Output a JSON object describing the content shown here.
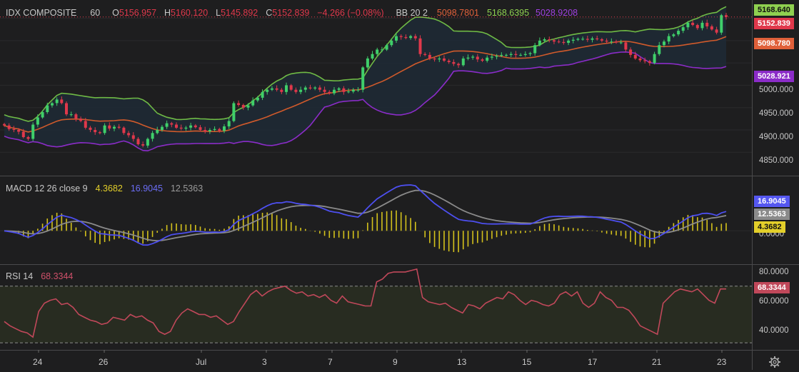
{
  "colors": {
    "bg": "#1e1e1f",
    "up": "#3fcf6a",
    "down": "#e0384b",
    "bb_upper": "#6fba45",
    "bb_basis": "#d05a2b",
    "bb_lower": "#8b2cc8",
    "bb_fill": "#1f2a36",
    "macd_line": "#4d4ff0",
    "signal_line": "#8a8a8a",
    "hist": "#d4c21c",
    "rsi_line": "#c0485a",
    "rsi_band": "#2a2f22",
    "grid": "#2a2a2c"
  },
  "main_header": {
    "symbol": "IDX COMPOSITE",
    "interval": "60",
    "o_label": "O",
    "o_value": "5156.957",
    "h_label": "H",
    "h_value": "5160.120",
    "l_label": "L",
    "l_value": "5145.892",
    "c_label": "C",
    "c_value": "5152.839",
    "change": "−4.266 (−0.08%)",
    "bb_label": "BB 20 2",
    "bb_basis": "5098.7801",
    "bb_upper": "5168.6395",
    "bb_lower": "5028.9208"
  },
  "macd_header": {
    "label": "MACD 12 26 close 9",
    "hist": "4.3682",
    "macd": "16.9045",
    "signal": "12.5363"
  },
  "rsi_header": {
    "label": "RSI 14",
    "value": "68.3344"
  },
  "price_axis": {
    "ticks": [
      "5000.000",
      "4950.000",
      "4900.000",
      "4850.000"
    ],
    "badges": {
      "upper": "5168.640",
      "close": "5152.839",
      "basis": "5098.780",
      "lower": "5028.921"
    }
  },
  "macd_axis": {
    "ticks": [
      "0.0000"
    ],
    "badges": {
      "macd": "16.9045",
      "signal": "12.5363",
      "hist": "4.3682"
    }
  },
  "rsi_axis": {
    "ticks": [
      "80.0000",
      "60.0000",
      "40.0000"
    ],
    "badge": "68.3344"
  },
  "time_axis": [
    "24",
    "26",
    "Jul",
    "3",
    "7",
    "9",
    "13",
    "15",
    "17",
    "21",
    "23"
  ],
  "settings_icon": "gear-icon",
  "chart_data": [
    {
      "type": "candlestick",
      "title": "IDX COMPOSITE",
      "interval": "60",
      "ylim": [
        4820,
        5175
      ],
      "x_ticks": [
        "24",
        "26",
        "Jul",
        "3",
        "7",
        "9",
        "13",
        "15",
        "17",
        "21",
        "23"
      ],
      "close": [
        4910,
        4902,
        4900,
        4896,
        4884,
        4880,
        4912,
        4928,
        4940,
        4955,
        4960,
        4968,
        4960,
        4935,
        4935,
        4925,
        4920,
        4905,
        4900,
        4895,
        4893,
        4910,
        4903,
        4907,
        4905,
        4893,
        4888,
        4880,
        4868,
        4865,
        4880,
        4893,
        4900,
        4907,
        4915,
        4912,
        4905,
        4903,
        4905,
        4910,
        4906,
        4900,
        4897,
        4900,
        4902,
        4898,
        4908,
        4920,
        4960,
        4956,
        4950,
        4955,
        4966,
        4972,
        4985,
        4990,
        4993,
        4990,
        4985,
        5000,
        4990,
        4985,
        4990,
        4995,
        4993,
        4995,
        4990,
        4985,
        4982,
        4990,
        4993,
        4985,
        4986,
        4990,
        4990,
        5040,
        5060,
        5070,
        5080,
        5080,
        5090,
        5100,
        5110,
        5108,
        5106,
        5110,
        5105,
        5070,
        5068,
        5060,
        5058,
        5060,
        5055,
        5052,
        5048,
        5045,
        5060,
        5062,
        5064,
        5058,
        5055,
        5062,
        5064,
        5066,
        5068,
        5068,
        5070,
        5068,
        5068,
        5070,
        5072,
        5090,
        5100,
        5103,
        5101,
        5098,
        5097,
        5095,
        5100,
        5102,
        5104,
        5104,
        5102,
        5105,
        5103,
        5100,
        5098,
        5098,
        5096,
        5096,
        5080,
        5068,
        5060,
        5056,
        5054,
        5050,
        5070,
        5090,
        5098,
        5110,
        5114,
        5122,
        5130,
        5140,
        5135,
        5128,
        5140,
        5132,
        5125,
        5118,
        5157,
        5153
      ],
      "bollinger": {
        "length": 20,
        "mult": 2,
        "basis": 5098.7801,
        "upper": 5168.6395,
        "lower": 5028.9208
      }
    },
    {
      "type": "line",
      "title": "MACD 12 26 close 9",
      "series": [
        {
          "name": "MACD",
          "last": 16.9045
        },
        {
          "name": "Signal",
          "last": 12.5363
        },
        {
          "name": "Histogram",
          "last": 4.3682
        }
      ]
    },
    {
      "type": "line",
      "title": "RSI 14",
      "ylim": [
        25,
        85
      ],
      "y_ticks": [
        "80.0000",
        "60.0000",
        "40.0000"
      ],
      "bands": [
        30,
        70
      ],
      "values": [
        45,
        42,
        40,
        38,
        37,
        34,
        52,
        58,
        60,
        61,
        57,
        58,
        55,
        50,
        48,
        46,
        45,
        43,
        44,
        48,
        47,
        46,
        50,
        48,
        49,
        46,
        44,
        38,
        36,
        38,
        46,
        51,
        54,
        52,
        50,
        50,
        48,
        49,
        46,
        43,
        45,
        52,
        58,
        64,
        67,
        63,
        66,
        68,
        69,
        70,
        67,
        65,
        66,
        63,
        64,
        62,
        64,
        60,
        58,
        63,
        59,
        58,
        57,
        56,
        56,
        73,
        75,
        79,
        80,
        80,
        80,
        81,
        82,
        62,
        59,
        58,
        57,
        58,
        55,
        53,
        51,
        57,
        56,
        54,
        58,
        60,
        62,
        61,
        66,
        64,
        60,
        57,
        60,
        59,
        57,
        56,
        58,
        64,
        66,
        63,
        66,
        58,
        55,
        58,
        66,
        62,
        60,
        55,
        55,
        53,
        48,
        42,
        40,
        38,
        36,
        58,
        62,
        66,
        68,
        67,
        66,
        68,
        64,
        60,
        58,
        68,
        68
      ],
      "last": 68.3344
    }
  ]
}
